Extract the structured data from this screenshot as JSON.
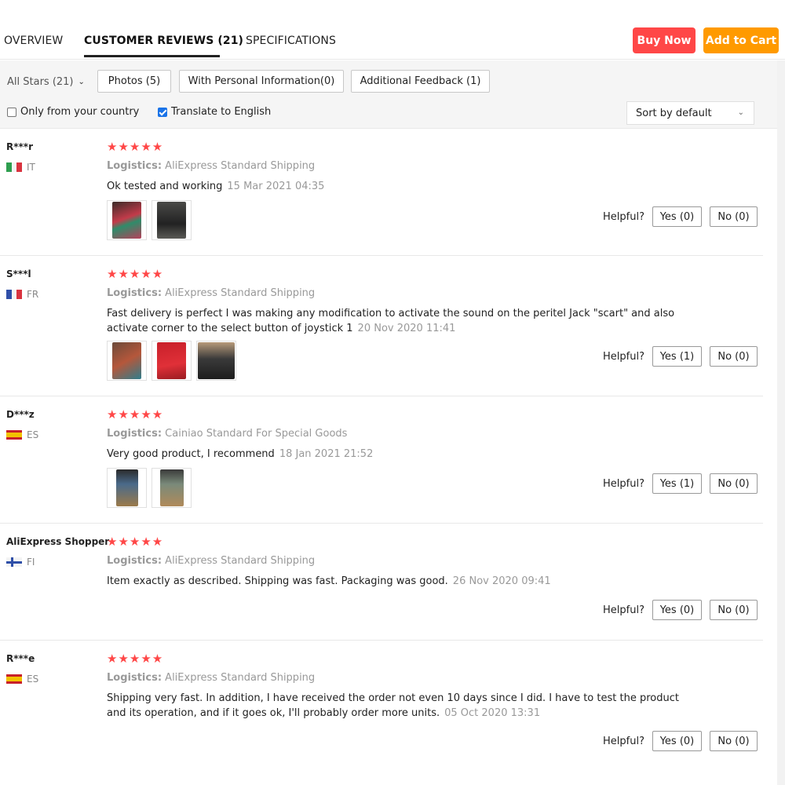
{
  "tabs": {
    "overview": "OVERVIEW",
    "reviews": "CUSTOMER REVIEWS (21)",
    "specs": "SPECIFICATIONS",
    "buy_now": "Buy Now",
    "add_to_cart": "Add to Cart"
  },
  "filters": {
    "all_stars": "All Stars (21)",
    "photos": "Photos (5)",
    "personal": "With Personal Information(0)",
    "additional": "Additional Feedback (1)",
    "only_country": "Only from your country",
    "translate": "Translate to English",
    "sort": "Sort by default"
  },
  "colors": {
    "buy": "#ff4747",
    "cart": "#ff9a00",
    "stars": "#ff4747"
  },
  "reviews": [
    {
      "name": "R***r",
      "country": "IT",
      "stars": "★★★★★",
      "logistics_label": "Logistics:",
      "logistics": "AliExpress Standard Shipping",
      "text": "Ok tested and working",
      "date": "15 Mar 2021 04:35",
      "helpful": "Helpful?",
      "yes": "Yes (0)",
      "no": "No (0)"
    },
    {
      "name": "S***l",
      "country": "FR",
      "stars": "★★★★★",
      "logistics_label": "Logistics:",
      "logistics": "AliExpress Standard Shipping",
      "text": "Fast delivery is perfect I was making any modification to activate the sound on the peritel Jack \"scart\" and also activate corner to the select button of joystick 1",
      "date": "20 Nov 2020 11:41",
      "helpful": "Helpful?",
      "yes": "Yes (1)",
      "no": "No (0)"
    },
    {
      "name": "D***z",
      "country": "ES",
      "stars": "★★★★★",
      "logistics_label": "Logistics:",
      "logistics": "Cainiao Standard For Special Goods",
      "text": "Very good product, I recommend",
      "date": "18 Jan 2021 21:52",
      "helpful": "Helpful?",
      "yes": "Yes (1)",
      "no": "No (0)"
    },
    {
      "name": "AliExpress Shopper",
      "country": "FI",
      "stars": "★★★★★",
      "logistics_label": "Logistics:",
      "logistics": "AliExpress Standard Shipping",
      "text": "Item exactly as described. Shipping was fast. Packaging was good.",
      "date": "26 Nov 2020 09:41",
      "helpful": "Helpful?",
      "yes": "Yes (0)",
      "no": "No (0)"
    },
    {
      "name": "R***e",
      "country": "ES",
      "stars": "★★★★★",
      "logistics_label": "Logistics:",
      "logistics": "AliExpress Standard Shipping",
      "text": "Shipping very fast. In addition, I have received the order not even 10 days since I did. I have to test the product and its operation, and if it goes ok, I'll probably order more units.",
      "date": "05 Oct 2020 13:31",
      "helpful": "Helpful?",
      "yes": "Yes (0)",
      "no": "No (0)"
    }
  ]
}
